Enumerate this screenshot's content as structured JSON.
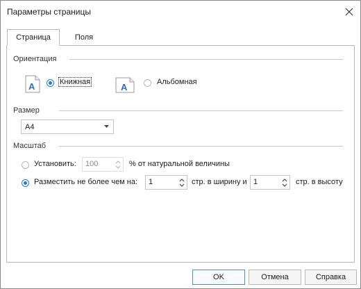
{
  "window": {
    "title": "Параметры страницы"
  },
  "tabs": [
    {
      "label": "Страница",
      "active": true
    },
    {
      "label": "Поля",
      "active": false
    }
  ],
  "orientation": {
    "group_label": "Ориентация",
    "portrait_label": "Книжная",
    "landscape_label": "Альбомная",
    "selected": "portrait",
    "icon_letter": "A"
  },
  "size": {
    "group_label": "Размер",
    "selected": "A4"
  },
  "scale": {
    "group_label": "Масштаб",
    "set_label": "Установить:",
    "set_value": "100",
    "set_suffix": "% от натуральной величины",
    "fit_label": "Разместить не более чем на:",
    "fit_width_value": "1",
    "fit_width_suffix": "стр. в ширину и",
    "fit_height_value": "1",
    "fit_height_suffix": "стр. в высоту",
    "selected": "fit"
  },
  "buttons": {
    "ok": "OK",
    "cancel": "Отмена",
    "help": "Справка"
  },
  "colors": {
    "accent": "#1c7cd5",
    "icon_letter": "#2f6db6"
  }
}
